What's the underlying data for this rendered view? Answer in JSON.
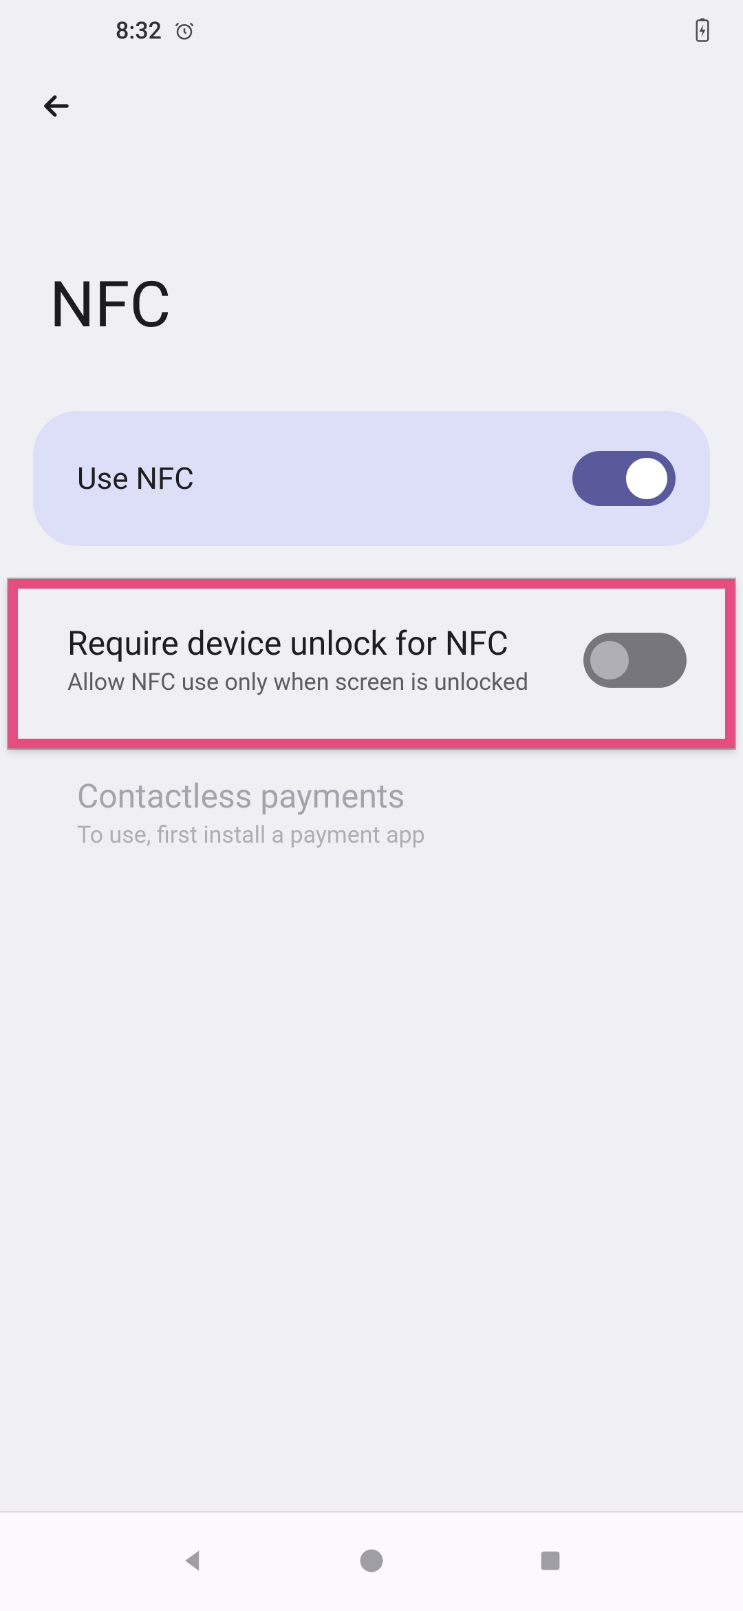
{
  "status_bar": {
    "time": "8:32"
  },
  "page": {
    "title": "NFC"
  },
  "settings": {
    "use_nfc": {
      "label": "Use NFC",
      "state": "on"
    },
    "require_unlock": {
      "label": "Require device unlock for NFC",
      "sub": "Allow NFC use only when screen is unlocked",
      "state": "off",
      "highlighted": true
    },
    "contactless": {
      "label": "Contactless payments",
      "sub": "To use, first install a payment app",
      "enabled": false
    }
  }
}
